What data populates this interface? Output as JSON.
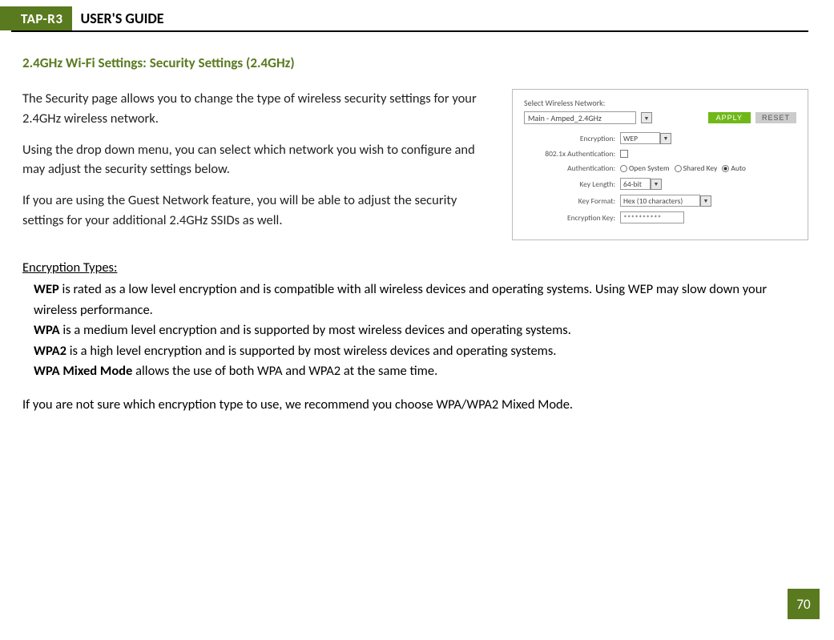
{
  "header": {
    "badge": "TAP-R3",
    "title": "USER'S GUIDE"
  },
  "section_heading": "2.4GHz Wi-Fi Settings: Security Settings (2.4GHz)",
  "paragraphs": {
    "p1": "The Security page allows you to change the type of wireless security settings for your 2.4GHz wireless network.",
    "p2": "Using the drop down menu, you can select which network you wish to configure and may adjust the security settings below.",
    "p3": "If you are using the Guest Network feature, you will be able to adjust the security settings for your additional 2.4GHz SSIDs as well."
  },
  "figure": {
    "select_label": "Select Wireless Network:",
    "network_value": "Main - Amped_2.4GHz",
    "apply": "APPLY",
    "reset": "RESET",
    "rows": {
      "encryption_label": "Encryption:",
      "encryption_value": "WEP",
      "auth8021x_label": "802.1x Authentication:",
      "auth_label": "Authentication:",
      "auth_open": "Open System",
      "auth_shared": "Shared Key",
      "auth_auto": "Auto",
      "keylen_label": "Key Length:",
      "keylen_value": "64-bit",
      "keyfmt_label": "Key Format:",
      "keyfmt_value": "Hex (10 characters)",
      "enckey_label": "Encryption Key:",
      "enckey_value": "**********"
    }
  },
  "encryption": {
    "heading": "Encryption Types:",
    "wep_b": "WEP",
    "wep_t": " is rated as a low level encryption and is compatible with all wireless devices and operating systems. Using WEP may slow down your wireless performance.",
    "wpa_b": "WPA",
    "wpa_t": " is a medium level encryption and is supported by most wireless devices and operating systems.",
    "wpa2_b": "WPA2",
    "wpa2_t": " is a high level encryption and is supported by most wireless devices and operating systems.",
    "mixed_b": "WPA Mixed Mode",
    "mixed_t": " allows the use of both WPA and WPA2 at the same time."
  },
  "footer_text": "If you are not sure which encryption type to use, we recommend you choose WPA/WPA2 Mixed Mode.",
  "page_number": "70"
}
